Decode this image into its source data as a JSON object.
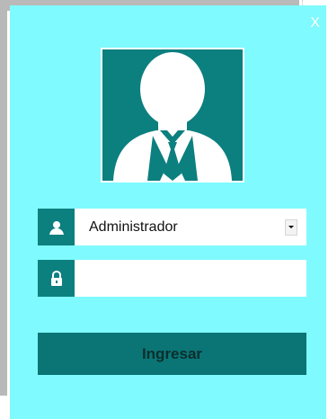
{
  "window": {
    "close_label": "X"
  },
  "avatar": {
    "icon": "user-avatar-icon"
  },
  "login": {
    "user_icon": "user-icon",
    "user_select_value": "Administrador",
    "password_icon": "lock-icon",
    "password_value": "",
    "submit_label": "Ingresar"
  },
  "colors": {
    "panel_background": "#7ffaff",
    "accent": "#0c7f7f",
    "field_background": "#ffffff",
    "close_color": "#ffffff"
  }
}
